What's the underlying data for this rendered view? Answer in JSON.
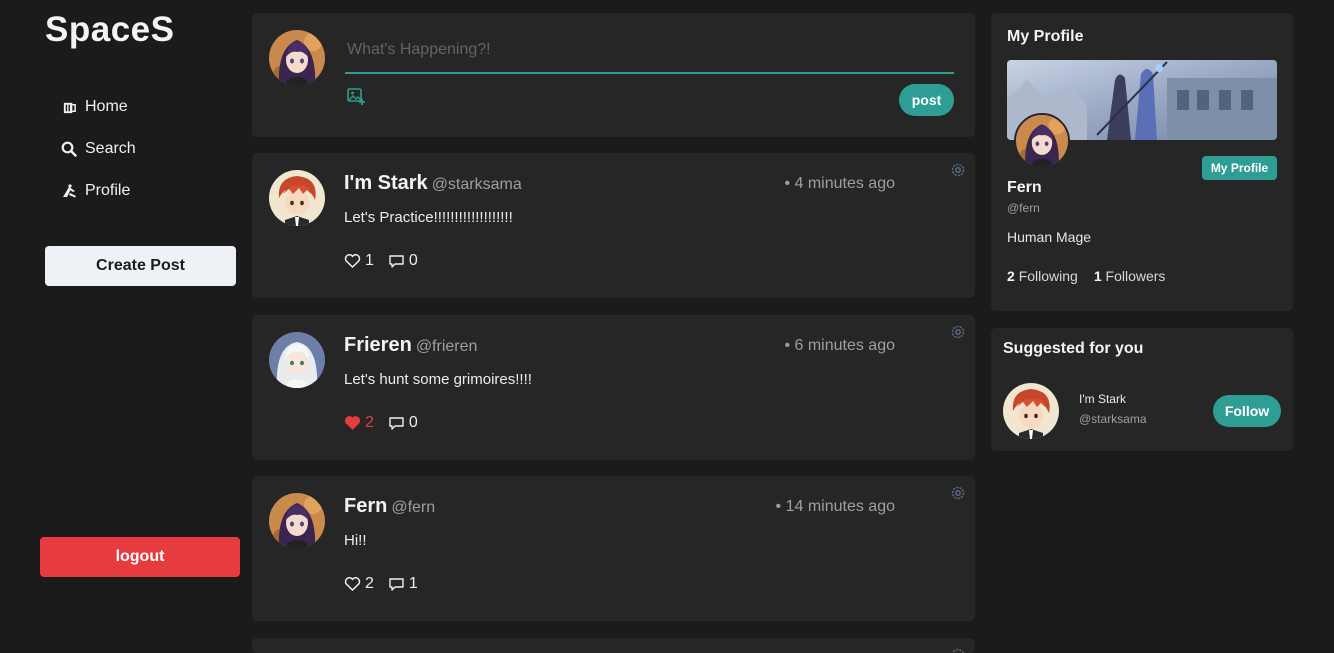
{
  "app": {
    "brand": "SpaceS"
  },
  "sidebar": {
    "items": [
      {
        "label": "Home",
        "icon": "home-icon"
      },
      {
        "label": "Search",
        "icon": "search-icon"
      },
      {
        "label": "Profile",
        "icon": "profile-icon"
      }
    ],
    "create_post_label": "Create Post",
    "logout_label": "logout"
  },
  "composer": {
    "placeholder": "What's Happening?!",
    "post_label": "post"
  },
  "feed": {
    "posts": [
      {
        "name": "I'm Stark",
        "handle": "@starksama",
        "time": "• 4 minutes ago",
        "body": "Let's Practice!!!!!!!!!!!!!!!!!!!",
        "likes": "1",
        "comments": "0",
        "liked": false
      },
      {
        "name": "Frieren",
        "handle": "@frieren",
        "time": "• 6 minutes ago",
        "body": "Let's hunt some grimoires!!!!",
        "likes": "2",
        "comments": "0",
        "liked": true
      },
      {
        "name": "Fern",
        "handle": "@fern",
        "time": "• 14 minutes ago",
        "body": "Hi!!",
        "likes": "2",
        "comments": "1",
        "liked": false
      }
    ]
  },
  "profile": {
    "title": "My Profile",
    "button_label": "My Profile",
    "name": "Fern",
    "handle": "@fern",
    "bio": "Human Mage",
    "following_count": "2",
    "following_label": "Following",
    "followers_count": "1",
    "followers_label": "Followers"
  },
  "suggested": {
    "title": "Suggested for you",
    "users": [
      {
        "name": "I'm Stark",
        "handle": "@starksama",
        "follow_label": "Follow"
      }
    ]
  },
  "colors": {
    "accent": "#2e9d94",
    "danger": "#e63b3f",
    "background": "#1b1b1b",
    "card": "#262626"
  }
}
